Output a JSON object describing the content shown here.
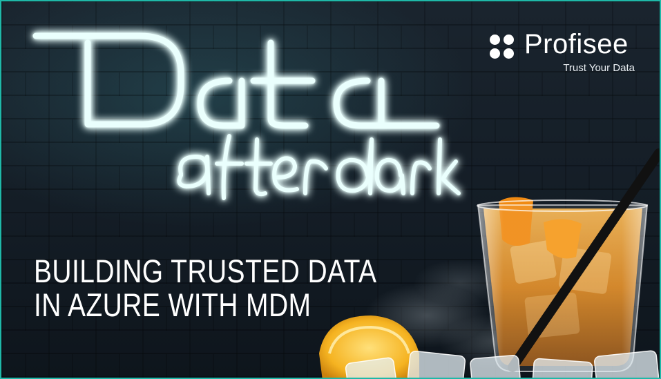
{
  "neon": {
    "line1": "Data",
    "line2": "after dark",
    "glow_color": "#8ff5ec"
  },
  "logo": {
    "name": "Profisee",
    "tagline": "Trust Your Data"
  },
  "headline": {
    "line1": "BUILDING TRUSTED DATA",
    "line2": "IN AZURE WITH MDM"
  },
  "colors": {
    "frame": "#1fb8a8",
    "neon": "#8ff5ec",
    "drink": "#e58f1e",
    "text": "#ffffff"
  },
  "icons": [
    "profisee-logo-dots-icon",
    "cocktail-glass-illustration",
    "lemon-slice-illustration",
    "ice-cubes-illustration",
    "straw-illustration"
  ]
}
